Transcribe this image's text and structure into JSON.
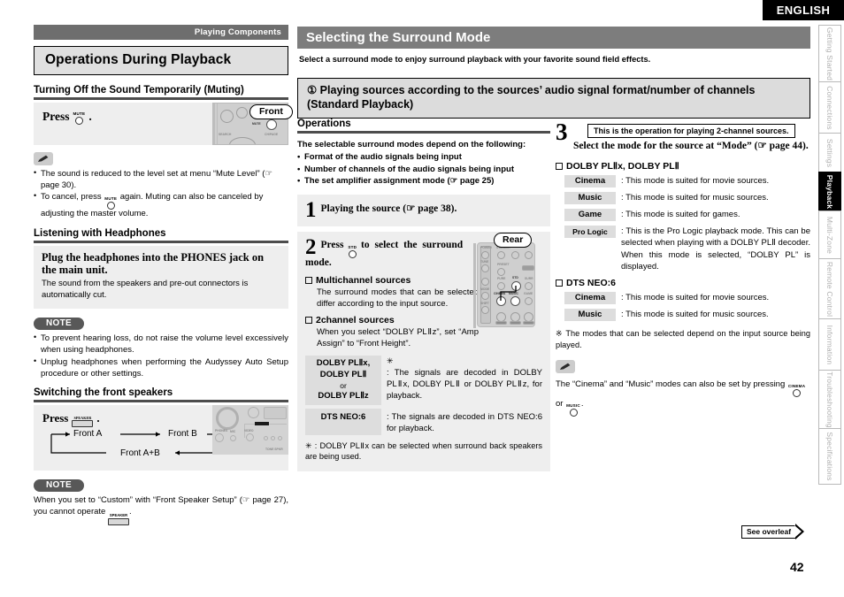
{
  "language_banner": "ENGLISH",
  "page_number": "42",
  "see_overleaf": "See overleaf",
  "tabs": [
    {
      "label": "Getting Started",
      "active": false
    },
    {
      "label": "Connections",
      "active": false
    },
    {
      "label": "Settings",
      "active": false
    },
    {
      "label": "Playback",
      "active": true
    },
    {
      "label": "Multi-Zone",
      "active": false
    },
    {
      "label": "Remote Control",
      "active": false
    },
    {
      "label": "Information",
      "active": false
    },
    {
      "label": "Troubleshooting",
      "active": false
    },
    {
      "label": "Specifications",
      "active": false
    }
  ],
  "left": {
    "section_strip": "Playing Components",
    "title": "Operations During Playback",
    "muting": {
      "heading": "Turning Off the Sound Temporarily (Muting)",
      "press_prefix": "Press",
      "press_key": "MUTE",
      "press_suffix": ".",
      "callout": "Front",
      "notes": [
        "The sound is reduced to the level set at menu “Mute Level” (☞ page 30).",
        "To cancel, press  again. Muting can also be canceled by adjusting the master volume."
      ],
      "note2_pre": "To cancel, press",
      "note2_key": "MUTE",
      "note2_post": "again. Muting can also be canceled by adjusting the master volume."
    },
    "headphones": {
      "heading": "Listening with Headphones",
      "panel_title": "Plug the headphones into the PHONES jack on the main unit.",
      "panel_body": "The sound from the speakers and pre-out connectors is automatically cut.",
      "note_label": "NOTE",
      "notes": [
        "To prevent hearing loss, do not raise the volume level excessively when using headphones.",
        "Unplug headphones when performing the Audyssey Auto Setup procedure or other settings."
      ]
    },
    "front_speakers": {
      "heading": "Switching the front speakers",
      "press_prefix": "Press",
      "press_key": "SPEAKER",
      "press_suffix": ".",
      "flow": [
        "Front A",
        "Front B",
        "Front A+B"
      ],
      "note_label": "NOTE",
      "note_pre": "When you set to “Custom” with “Front Speaker Setup” (☞ page 27), you cannot operate",
      "note_key": "SPEAKER",
      "note_post": "."
    }
  },
  "middle": {
    "banner_title": "Selecting the Surround Mode",
    "intro": "Select a surround mode to enjoy surround playback with your favorite sound field effects.",
    "box_heading_line1": "① Playing sources according to the sources’ audio signal format/number of channels",
    "box_heading_line2": "(Standard Playback)",
    "operations_heading": "Operations",
    "depend_intro": "The selectable surround modes depend on the following:",
    "depend_items": [
      "Format of the audio signals being input",
      "Number of channels of the audio signals being input",
      "The set amplifier assignment mode (☞ page 25)"
    ],
    "step1": {
      "num": "1",
      "text": "Playing the source (☞ page 38)."
    },
    "step2": {
      "num": "2",
      "text_pre": "Press",
      "key": "STD",
      "text_post": "to select the surround mode.",
      "callout": "Rear",
      "sections": [
        {
          "title": "Multichannel sources",
          "body": "The surround modes that can be selected differ according to the input source."
        },
        {
          "title": "2channel sources",
          "body": "When you select “DOLBY PLⅡz”, set “Amp Assign” to “Front Height”."
        }
      ],
      "mode_table": [
        {
          "key_lines": [
            "DOLBY PLⅡx,",
            "DOLBY PLⅡ",
            "or",
            "DOLBY PLⅡz"
          ],
          "star": "✳",
          "value": ": The signals are decoded in DOLBY PLⅡx, DOLBY PLⅡ or DOLBY PLⅡz, for playback."
        },
        {
          "key_lines": [
            "DTS NEO:6"
          ],
          "star": "",
          "value": ": The signals are decoded in DTS NEO:6 for playback."
        }
      ],
      "footnote": "✳ : DOLBY PLⅡx can be selected when surround back speakers are being used."
    }
  },
  "right": {
    "step3": {
      "num": "3",
      "flag": "This is the operation for playing 2-channel sources.",
      "text": "Select the mode for the source at “Mode” (☞ page 44)."
    },
    "group1": {
      "title": "DOLBY PLⅡx, DOLBY PLⅡ",
      "rows": [
        {
          "key": "Cinema",
          "value": ": This mode is suited for movie sources."
        },
        {
          "key": "Music",
          "value": ": This mode is suited for music sources."
        },
        {
          "key": "Game",
          "value": ": This mode is suited for games."
        },
        {
          "key": "Pro Logic",
          "value": ": This is the Pro Logic playback mode. This can be selected when playing with a DOLBY PLⅡ decoder. When this mode is selected, “DOLBY PL” is displayed."
        }
      ]
    },
    "group2": {
      "title": "DTS NEO:6",
      "rows": [
        {
          "key": "Cinema",
          "value": ": This mode is suited for movie sources."
        },
        {
          "key": "Music",
          "value": ": This mode is suited for music sources."
        }
      ]
    },
    "note_star": "※ The modes that can be selected depend on the input source being played.",
    "tip_pre": "The “Cinema” and “Music” modes can also be set by pressing",
    "tip_key1": "CINEMA",
    "tip_mid": "or",
    "tip_key2": "MUSIC",
    "tip_post": "."
  }
}
